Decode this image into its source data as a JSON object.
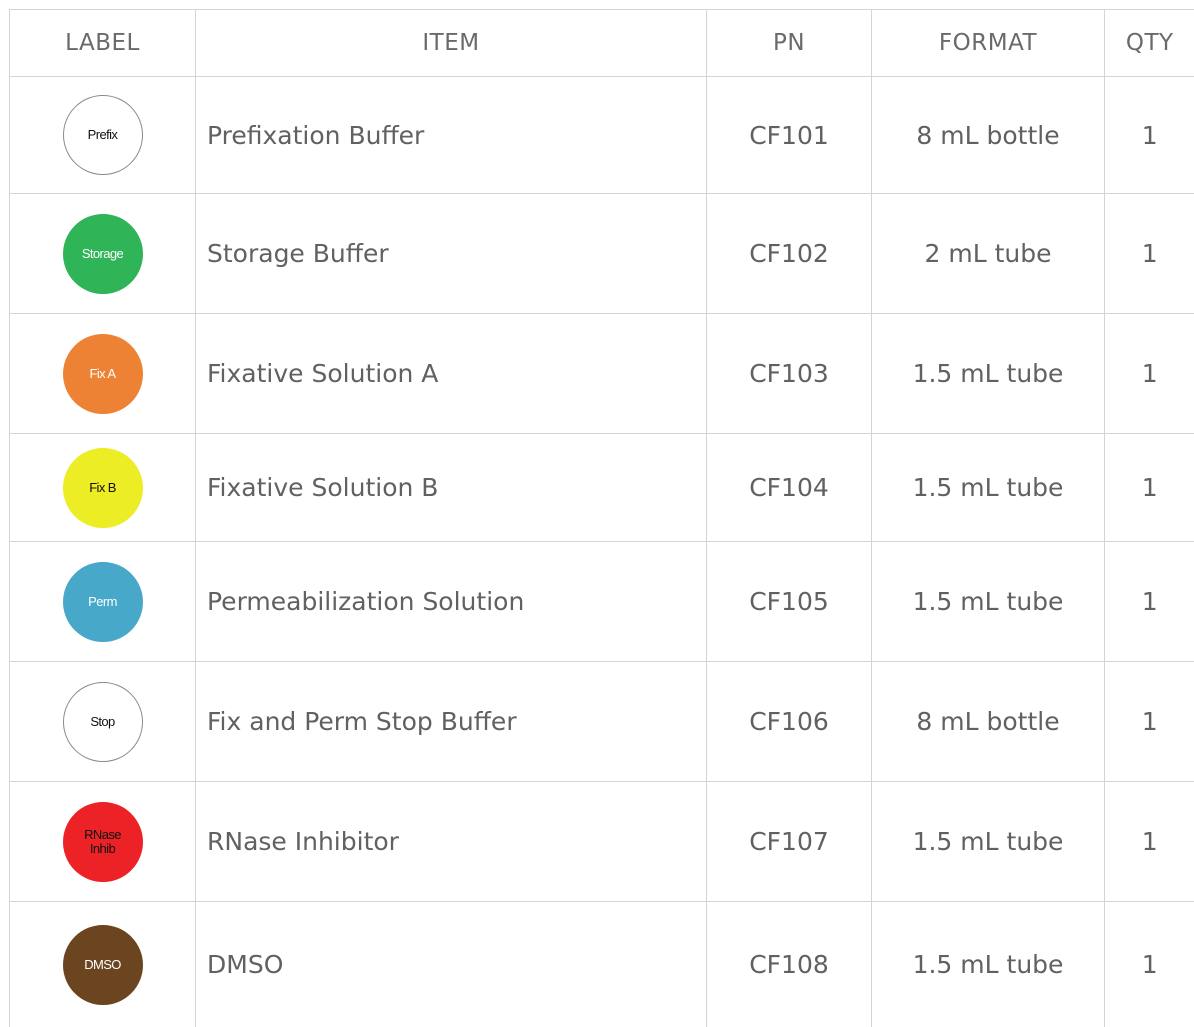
{
  "header": {
    "label": "LABEL",
    "item": "ITEM",
    "pn": "PN",
    "format": "FORMAT",
    "qty": "QTY"
  },
  "rows": [
    {
      "label": "Prefix",
      "label_bg": "#ffffff",
      "label_border": "#8a8a8a",
      "label_text_color": "#111111",
      "item": "Prefixation Buffer",
      "pn": "CF101",
      "format": "8 mL bottle",
      "qty": "1"
    },
    {
      "label": "Storage",
      "label_bg": "#2fb457",
      "label_border": "#2fb457",
      "label_text_color": "#ffffff",
      "item": "Storage Buffer",
      "pn": "CF102",
      "format": "2 mL tube",
      "qty": "1"
    },
    {
      "label": "Fix A",
      "label_bg": "#ee8234",
      "label_border": "#ee8234",
      "label_text_color": "#ffffff",
      "item": "Fixative Solution A",
      "pn": "CF103",
      "format": "1.5 mL tube",
      "qty": "1"
    },
    {
      "label": "Fix B",
      "label_bg": "#eced25",
      "label_border": "#eced25",
      "label_text_color": "#111111",
      "item": "Fixative Solution B",
      "pn": "CF104",
      "format": "1.5 mL tube",
      "qty": "1"
    },
    {
      "label": "Perm",
      "label_bg": "#47a8c9",
      "label_border": "#47a8c9",
      "label_text_color": "#ffffff",
      "item": "Permeabilization Solution",
      "pn": "CF105",
      "format": "1.5 mL tube",
      "qty": "1"
    },
    {
      "label": "Stop",
      "label_bg": "#ffffff",
      "label_border": "#8a8a8a",
      "label_text_color": "#111111",
      "item": "Fix and Perm Stop Buffer",
      "pn": "CF106",
      "format": "8 mL bottle",
      "qty": "1"
    },
    {
      "label": "RNase\nInhib",
      "label_bg": "#ec2227",
      "label_border": "#ec2227",
      "label_text_color": "#111111",
      "item": "RNase Inhibitor",
      "pn": "CF107",
      "format": "1.5 mL tube",
      "qty": "1"
    },
    {
      "label": "DMSO",
      "label_bg": "#6b451f",
      "label_border": "#6b451f",
      "label_text_color": "#ffffff",
      "item": "DMSO",
      "pn": "CF108",
      "format": "1.5 mL tube",
      "qty": "1"
    }
  ]
}
